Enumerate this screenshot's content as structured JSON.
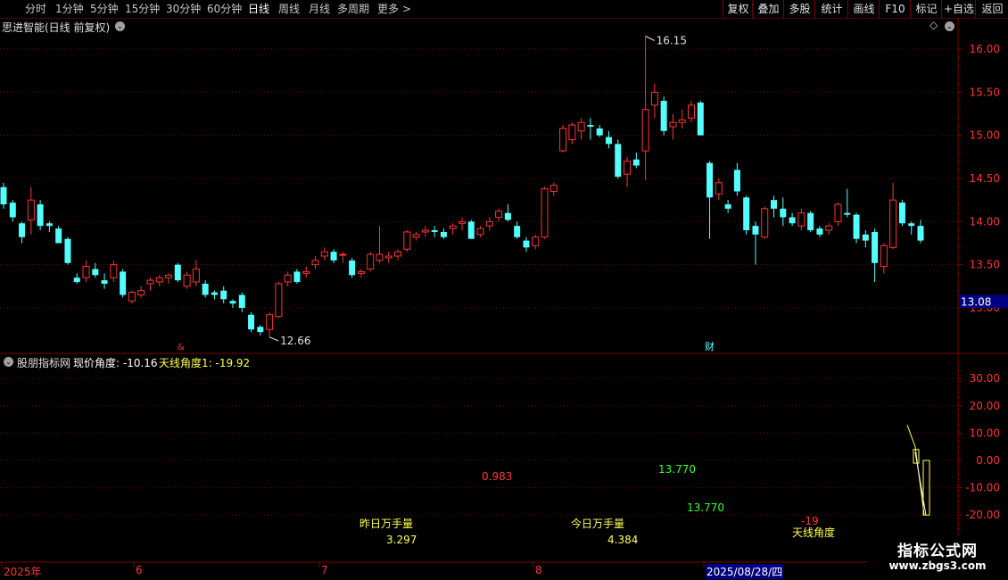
{
  "toolbar": {
    "periods": [
      "分时",
      "1分钟",
      "5分钟",
      "15分钟",
      "30分钟",
      "60分钟",
      "日线",
      "周线",
      "月线",
      "多周期",
      "更多"
    ],
    "active_period": "日线",
    "more_arrow": ">",
    "buttons": [
      "复权",
      "叠加",
      "多股",
      "统计",
      "画线",
      "F10",
      "标记",
      "+自选",
      "返回"
    ]
  },
  "main_chart": {
    "title": "思进智能(日线 前复权)",
    "yaxis_ticks": [
      "16.00",
      "15.50",
      "15.00",
      "14.50",
      "14.00",
      "13.50",
      "13.00"
    ],
    "price_range": [
      12.5,
      16.4
    ],
    "current_price": "13.08",
    "high_marker": "16.15",
    "low_marker": "12.66",
    "event_marker": "财",
    "small_marker": "&"
  },
  "indicator": {
    "name": "股朋指标网",
    "label1": "现价角度: -10.16",
    "label2": "天线角度1: -19.92",
    "yaxis_ticks": [
      "30.00",
      "20.00",
      "10.00",
      "0.00",
      "-10.00",
      "-20.00"
    ],
    "value_range": [
      -27,
      37
    ],
    "texts": {
      "v1": "0.983",
      "v2": "13.770",
      "v3": "13.770",
      "yesterday_label": "昨日万手量",
      "yesterday_value": "3.297",
      "today_label": "今日万手量",
      "today_value": "4.384",
      "angle_value": "-19",
      "angle_label": "天线角度"
    }
  },
  "date_axis": {
    "labels": [
      "2025年",
      "6",
      "7",
      "8"
    ],
    "highlight": "2025/08/28/四"
  },
  "watermark": {
    "title": "指标公式网",
    "url": "www.zbgs3.com"
  },
  "colors": {
    "up": "#ff3333",
    "down": "#54ffff",
    "grid": "#7a0000",
    "yellow": "#ffff54",
    "green": "#33ff33"
  },
  "chart_data": {
    "type": "candlestick",
    "title": "思进智能(日线 前复权)",
    "series": [
      {
        "name": "daily_ohlc",
        "ohlc": [
          [
            14.4,
            14.45,
            14.15,
            14.2
          ],
          [
            14.22,
            14.25,
            14.0,
            14.05
          ],
          [
            13.98,
            14.0,
            13.75,
            13.82
          ],
          [
            14.02,
            14.4,
            13.85,
            14.25
          ],
          [
            14.2,
            14.25,
            13.9,
            13.95
          ],
          [
            13.98,
            14.0,
            13.88,
            13.95
          ],
          [
            13.92,
            13.95,
            13.75,
            13.75
          ],
          [
            13.8,
            13.82,
            13.5,
            13.52
          ],
          [
            13.35,
            13.4,
            13.28,
            13.3
          ],
          [
            13.35,
            13.55,
            13.3,
            13.48
          ],
          [
            13.45,
            13.52,
            13.35,
            13.38
          ],
          [
            13.32,
            13.4,
            13.22,
            13.28
          ],
          [
            13.35,
            13.55,
            13.3,
            13.5
          ],
          [
            13.42,
            13.45,
            13.12,
            13.15
          ],
          [
            13.08,
            13.2,
            13.05,
            13.18
          ],
          [
            13.15,
            13.25,
            13.12,
            13.2
          ],
          [
            13.28,
            13.35,
            13.2,
            13.32
          ],
          [
            13.3,
            13.38,
            13.25,
            13.35
          ],
          [
            13.35,
            13.4,
            13.28,
            13.38
          ],
          [
            13.5,
            13.52,
            13.3,
            13.32
          ],
          [
            13.25,
            13.42,
            13.22,
            13.38
          ],
          [
            13.3,
            13.55,
            13.25,
            13.45
          ],
          [
            13.28,
            13.32,
            13.12,
            13.15
          ],
          [
            13.18,
            13.2,
            13.1,
            13.15
          ],
          [
            13.2,
            13.25,
            13.05,
            13.1
          ],
          [
            13.08,
            13.1,
            13.0,
            13.05
          ],
          [
            13.15,
            13.18,
            12.95,
            13.0
          ],
          [
            12.92,
            12.95,
            12.72,
            12.75
          ],
          [
            12.78,
            12.8,
            12.68,
            12.72
          ],
          [
            12.75,
            12.95,
            12.66,
            12.92
          ],
          [
            12.9,
            13.3,
            12.88,
            13.28
          ],
          [
            13.3,
            13.42,
            13.25,
            13.38
          ],
          [
            13.42,
            13.45,
            13.28,
            13.3
          ],
          [
            13.4,
            13.48,
            13.35,
            13.42
          ],
          [
            13.5,
            13.6,
            13.45,
            13.55
          ],
          [
            13.6,
            13.7,
            13.55,
            13.65
          ],
          [
            13.65,
            13.68,
            13.52,
            13.55
          ],
          [
            13.62,
            13.65,
            13.52,
            13.62
          ],
          [
            13.55,
            13.58,
            13.35,
            13.38
          ],
          [
            13.4,
            13.45,
            13.35,
            13.42
          ],
          [
            13.45,
            13.65,
            13.42,
            13.62
          ],
          [
            13.55,
            13.95,
            13.52,
            13.62
          ],
          [
            13.58,
            13.65,
            13.52,
            13.6
          ],
          [
            13.6,
            13.68,
            13.55,
            13.65
          ],
          [
            13.68,
            13.9,
            13.65,
            13.88
          ],
          [
            13.82,
            13.88,
            13.78,
            13.85
          ],
          [
            13.88,
            13.95,
            13.82,
            13.9
          ],
          [
            13.9,
            13.95,
            13.82,
            13.88
          ],
          [
            13.88,
            13.92,
            13.8,
            13.82
          ],
          [
            13.92,
            13.98,
            13.85,
            13.95
          ],
          [
            13.98,
            14.05,
            13.9,
            14.0
          ],
          [
            14.0,
            14.02,
            13.8,
            13.8
          ],
          [
            13.85,
            13.95,
            13.82,
            13.92
          ],
          [
            13.95,
            14.05,
            13.9,
            14.0
          ],
          [
            14.05,
            14.15,
            14.0,
            14.12
          ],
          [
            14.1,
            14.2,
            14.0,
            14.02
          ],
          [
            13.95,
            14.0,
            13.8,
            13.82
          ],
          [
            13.78,
            13.82,
            13.65,
            13.7
          ],
          [
            13.72,
            13.85,
            13.68,
            13.82
          ],
          [
            13.82,
            14.4,
            13.8,
            14.38
          ],
          [
            14.35,
            14.45,
            14.3,
            14.42
          ],
          [
            14.82,
            15.12,
            14.8,
            15.08
          ],
          [
            14.95,
            15.15,
            14.9,
            15.12
          ],
          [
            15.05,
            15.2,
            14.95,
            15.15
          ],
          [
            15.12,
            15.2,
            14.95,
            15.1
          ],
          [
            15.08,
            15.12,
            14.98,
            15.0
          ],
          [
            14.98,
            15.05,
            14.85,
            14.9
          ],
          [
            14.9,
            14.95,
            14.5,
            14.52
          ],
          [
            14.55,
            14.75,
            14.4,
            14.7
          ],
          [
            14.72,
            14.8,
            14.62,
            14.65
          ],
          [
            14.82,
            16.15,
            14.48,
            15.3
          ],
          [
            15.35,
            15.6,
            15.2,
            15.5
          ],
          [
            15.4,
            15.45,
            15.0,
            15.05
          ],
          [
            15.1,
            15.25,
            14.95,
            15.15
          ],
          [
            15.15,
            15.3,
            15.08,
            15.18
          ],
          [
            15.2,
            15.4,
            15.15,
            15.35
          ],
          [
            15.38,
            15.4,
            15.0,
            15.0
          ],
          [
            14.68,
            14.7,
            13.8,
            14.28
          ],
          [
            14.32,
            14.5,
            14.25,
            14.45
          ],
          [
            14.2,
            14.25,
            14.1,
            14.15
          ],
          [
            14.6,
            14.68,
            14.3,
            14.35
          ],
          [
            14.28,
            14.3,
            13.85,
            13.9
          ],
          [
            13.95,
            14.0,
            13.5,
            13.85
          ],
          [
            13.82,
            14.18,
            13.8,
            14.15
          ],
          [
            14.25,
            14.3,
            14.05,
            14.15
          ],
          [
            14.15,
            14.28,
            13.95,
            14.05
          ],
          [
            14.05,
            14.1,
            13.95,
            13.98
          ],
          [
            13.95,
            14.15,
            13.9,
            14.1
          ],
          [
            14.1,
            14.12,
            13.88,
            13.9
          ],
          [
            13.92,
            13.95,
            13.82,
            13.85
          ],
          [
            13.9,
            13.98,
            13.85,
            13.95
          ],
          [
            14.0,
            14.22,
            13.95,
            14.2
          ],
          [
            14.1,
            14.38,
            14.05,
            14.08
          ],
          [
            14.08,
            14.1,
            13.75,
            13.8
          ],
          [
            13.85,
            13.9,
            13.7,
            13.78
          ],
          [
            13.88,
            13.92,
            13.3,
            13.52
          ],
          [
            13.48,
            13.75,
            13.4,
            13.72
          ],
          [
            13.7,
            14.45,
            13.68,
            14.25
          ],
          [
            14.22,
            14.25,
            13.95,
            13.98
          ],
          [
            13.98,
            14.0,
            13.85,
            13.95
          ],
          [
            13.95,
            14.02,
            13.75,
            13.78
          ]
        ]
      }
    ]
  }
}
